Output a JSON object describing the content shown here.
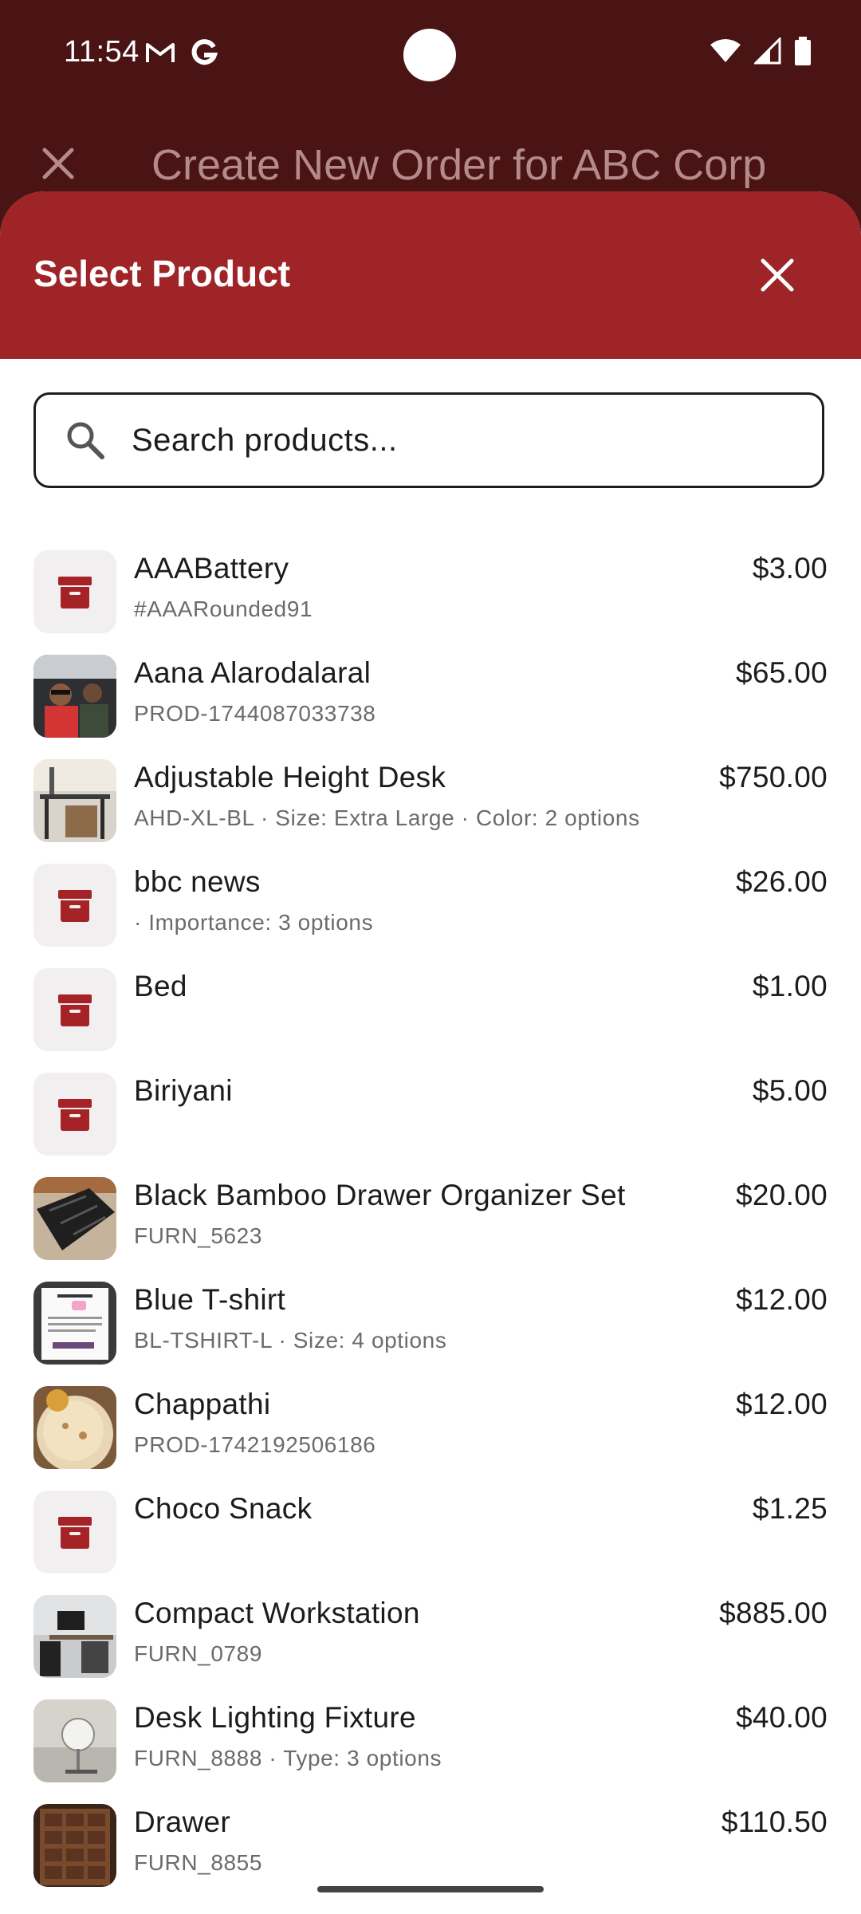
{
  "status_bar": {
    "time": "11:54",
    "left_icons": [
      "gmail-icon",
      "google-icon"
    ],
    "right_icons": [
      "wifi-icon",
      "signal-icon",
      "battery-icon"
    ]
  },
  "background_header": {
    "title": "Create New Order for ABC Corp",
    "close_icon": "close-icon"
  },
  "sheet": {
    "title": "Select Product",
    "close_icon": "close-icon"
  },
  "search": {
    "placeholder": "Search products...",
    "icon": "search-icon"
  },
  "colors": {
    "header_bg": "#9e2427",
    "status_bg": "#4a1414",
    "archive_icon": "#a52226"
  },
  "products": [
    {
      "name": "AAABattery",
      "sub": "#AAARounded91",
      "price": "$3.00",
      "thumb": "archive-box-icon"
    },
    {
      "name": "Aana Alarodalaral",
      "sub": "PROD-1744087033738",
      "price": "$65.00",
      "thumb": "photo-people-in-car"
    },
    {
      "name": "Adjustable Height Desk",
      "sub": "AHD-XL-BL · Size: Extra Large · Color: 2 options",
      "price": "$750.00",
      "thumb": "photo-office-desk"
    },
    {
      "name": "bbc news",
      "sub": " · Importance: 3 options",
      "price": "$26.00",
      "thumb": "archive-box-icon"
    },
    {
      "name": "Bed",
      "sub": "",
      "price": "$1.00",
      "thumb": "archive-box-icon"
    },
    {
      "name": "Biriyani",
      "sub": "",
      "price": "$5.00",
      "thumb": "archive-box-icon"
    },
    {
      "name": "Black Bamboo Drawer Organizer Set",
      "sub": "FURN_5623",
      "price": "$20.00",
      "thumb": "photo-drawer-organizer"
    },
    {
      "name": "Blue T-shirt",
      "sub": "BL-TSHIRT-L · Size: 4 options",
      "price": "$12.00",
      "thumb": "photo-report-screenshot"
    },
    {
      "name": "Chappathi",
      "sub": "PROD-1742192506186",
      "price": "$12.00",
      "thumb": "photo-chappathi"
    },
    {
      "name": "Choco Snack",
      "sub": "",
      "price": "$1.25",
      "thumb": "archive-box-icon"
    },
    {
      "name": "Compact Workstation",
      "sub": "FURN_0789",
      "price": "$885.00",
      "thumb": "photo-workstation"
    },
    {
      "name": "Desk Lighting Fixture",
      "sub": "FURN_8888 · Type: 3 options",
      "price": "$40.00",
      "thumb": "photo-desk-lamp"
    },
    {
      "name": "Drawer",
      "sub": "FURN_8855",
      "price": "$110.50",
      "thumb": "photo-drawer-cabinet"
    }
  ]
}
